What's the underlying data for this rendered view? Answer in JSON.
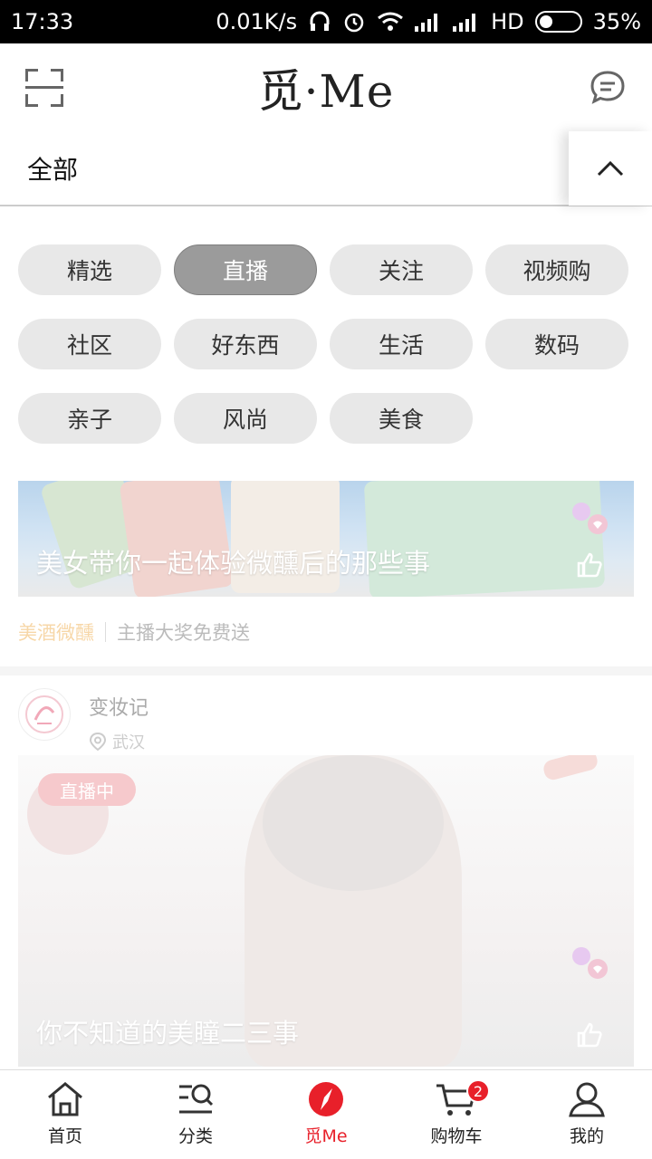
{
  "status_bar": {
    "time": "17:33",
    "speed": "0.01K/s",
    "network": "HD",
    "battery": "35%",
    "battery_level": 0.35
  },
  "header": {
    "logo": "觅·Me"
  },
  "category_bar": {
    "title": "全部"
  },
  "chips": [
    {
      "label": "精选",
      "active": false
    },
    {
      "label": "直播",
      "active": true
    },
    {
      "label": "关注",
      "active": false
    },
    {
      "label": "视频购",
      "active": false
    },
    {
      "label": "社区",
      "active": false
    },
    {
      "label": "好东西",
      "active": false
    },
    {
      "label": "生活",
      "active": false
    },
    {
      "label": "数码",
      "active": false
    },
    {
      "label": "亲子",
      "active": false
    },
    {
      "label": "风尚",
      "active": false
    },
    {
      "label": "美食",
      "active": false
    }
  ],
  "card1": {
    "caption": "美女带你一起体验微醺后的那些事",
    "tag_primary": "美酒微醺",
    "tag_secondary": "主播大奖免费送"
  },
  "card2": {
    "author_name": "变妆记",
    "location": "武汉",
    "live_badge": "直播中",
    "caption": "你不知道的美瞳二三事"
  },
  "bottom_nav": {
    "items": [
      {
        "label": "首页",
        "icon": "home-icon"
      },
      {
        "label": "分类",
        "icon": "category-search-icon"
      },
      {
        "label": "觅Me",
        "icon": "compass-icon",
        "active": true
      },
      {
        "label": "购物车",
        "icon": "cart-icon",
        "badge": "2"
      },
      {
        "label": "我的",
        "icon": "user-icon"
      }
    ]
  },
  "colors": {
    "accent": "#e8202a",
    "chip_bg": "#e8e8e8",
    "chip_active_bg": "#9b9b9b"
  }
}
